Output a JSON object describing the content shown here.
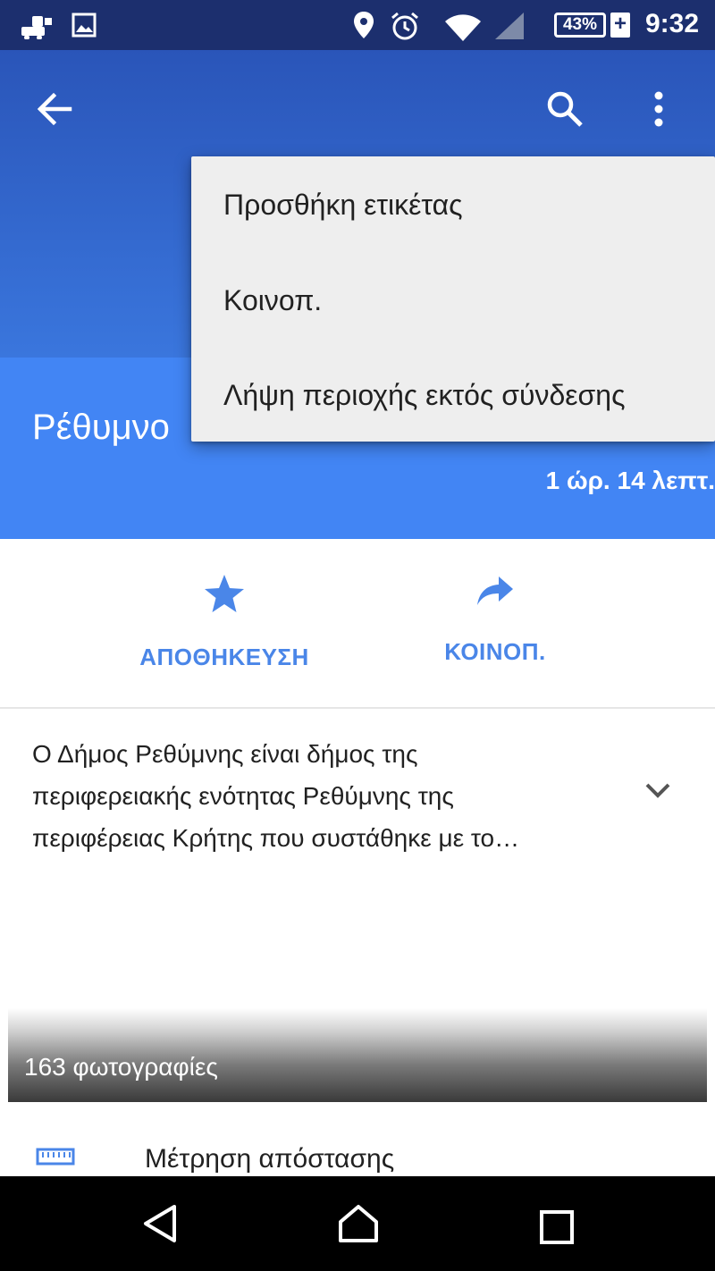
{
  "status_bar": {
    "time": "9:32",
    "battery": "43%",
    "battery_charging_glyph": "+",
    "icons": [
      "notification-icon",
      "image-icon",
      "location-icon",
      "alarm-icon",
      "wifi-icon",
      "signal-icon",
      "battery-icon"
    ]
  },
  "app_bar": {
    "back_icon": "arrow-back-icon",
    "search_icon": "search-icon",
    "more_icon": "more-vert-icon"
  },
  "overflow_menu": {
    "items": [
      "Προσθήκη ετικέτας",
      "Κοινοπ.",
      "Λήψη περιοχής εκτός σύνδεσης"
    ]
  },
  "place": {
    "title": "Ρέθυμνο",
    "travel_time": "1 ώρ. 14 λεπτ."
  },
  "actions": {
    "save_label": "ΑΠΟΘΗΚΕΥΣΗ",
    "share_label": "ΚΟΙΝΟΠ."
  },
  "description": {
    "line1": "Ο Δήμος Ρεθύμνης είναι δήμος της",
    "line2": "περιφερειακής ενότητας Ρεθύμνης της",
    "line3": "περιφέρειας Κρήτης που συστάθηκε με το…"
  },
  "photos": {
    "label": "163 φωτογραφίες"
  },
  "tools": {
    "measure_label": "Μέτρηση απόστασης"
  },
  "colors": {
    "status_bar": "#1c2f6e",
    "header": "#2a55b9",
    "place_band": "#4285f4",
    "accent": "#4a86e8",
    "menu_bg": "#eeeeee"
  }
}
